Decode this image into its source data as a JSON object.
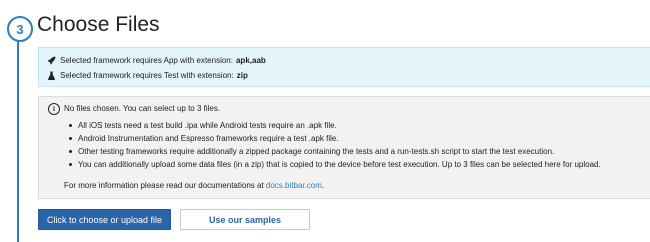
{
  "step": {
    "number": "3",
    "title": "Choose Files"
  },
  "requirements": {
    "app": {
      "icon": "rocket-icon",
      "text": "Selected framework requires App with extension:",
      "value": "apk,aab"
    },
    "test": {
      "icon": "flask-icon",
      "text": "Selected framework requires Test with extension:",
      "value": "zip"
    }
  },
  "info": {
    "icon": "info-icon",
    "status": "No files chosen. You can select up to 3 files.",
    "bullets": [
      "All iOS tests need a test build .ipa while Android tests require an .apk file.",
      "Android Instrumentation and Espresso frameworks require a test .apk file.",
      "Other testing frameworks require additionally a zipped package containing the tests and a run-tests.sh script to start the test execution.",
      "You can additionally upload some data files (in a zip) that is copied to the device before test execution. Up to 3 files can be selected here for upload."
    ],
    "more_prefix": "For more information please read our documentations at ",
    "more_link": "docs.bitbar.com",
    "more_suffix": "."
  },
  "buttons": {
    "upload": "Click to choose or upload file",
    "samples": "Use our samples"
  },
  "colors": {
    "accent": "#2f7cc0",
    "primary_button": "#2b64a8",
    "requirements_bg": "#e3f4fb",
    "info_bg": "#f2f2f2"
  }
}
